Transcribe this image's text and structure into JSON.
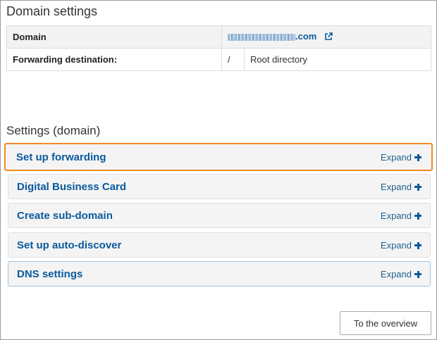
{
  "domain_settings": {
    "title": "Domain settings",
    "domain_label": "Domain",
    "domain_suffix": ".com",
    "forwarding_label": "Forwarding destination:",
    "forwarding_path": "/",
    "forwarding_value": "Root directory"
  },
  "settings": {
    "title": "Settings (domain)",
    "expand_label": "Expand",
    "items": [
      {
        "label": "Set up forwarding"
      },
      {
        "label": "Digital Business Card"
      },
      {
        "label": "Create sub-domain"
      },
      {
        "label": "Set up auto-discover"
      },
      {
        "label": "DNS settings"
      }
    ]
  },
  "footer": {
    "overview_button": "To the overview"
  },
  "colors": {
    "link": "#0a5a9c",
    "highlight": "#f08a24",
    "panel_bg": "#f4f4f4"
  },
  "icons": {
    "external_link": "external-link-icon",
    "expand": "plus-icon"
  }
}
